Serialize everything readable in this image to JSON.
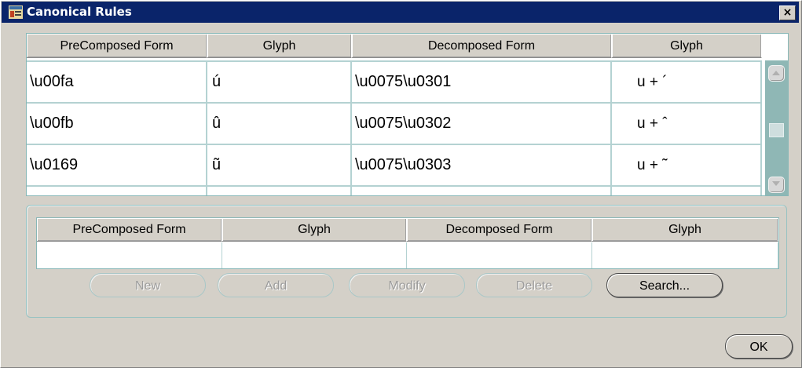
{
  "window": {
    "title": "Canonical Rules",
    "close_glyph": "×"
  },
  "rules_table": {
    "columns": [
      "PreComposed Form",
      "Glyph",
      "Decomposed Form",
      "Glyph"
    ],
    "rows": [
      {
        "precomposed": "\\u00fa",
        "glyph": "ú",
        "decomposed": "\\u0075\\u0301",
        "decomposed_glyph": "u + ´"
      },
      {
        "precomposed": "\\u00fb",
        "glyph": "û",
        "decomposed": "\\u0075\\u0302",
        "decomposed_glyph": "u + ˆ"
      },
      {
        "precomposed": "\\u0169",
        "glyph": "ũ",
        "decomposed": "\\u0075\\u0303",
        "decomposed_glyph": "u + ˜"
      }
    ]
  },
  "edit_table": {
    "columns": [
      "PreComposed Form",
      "Glyph",
      "Decomposed Form",
      "Glyph"
    ],
    "row": {
      "precomposed": "",
      "glyph": "",
      "decomposed": "",
      "decomposed_glyph": ""
    }
  },
  "buttons": {
    "new": "New",
    "add": "Add",
    "modify": "Modify",
    "delete": "Delete",
    "search": "Search...",
    "ok": "OK"
  }
}
